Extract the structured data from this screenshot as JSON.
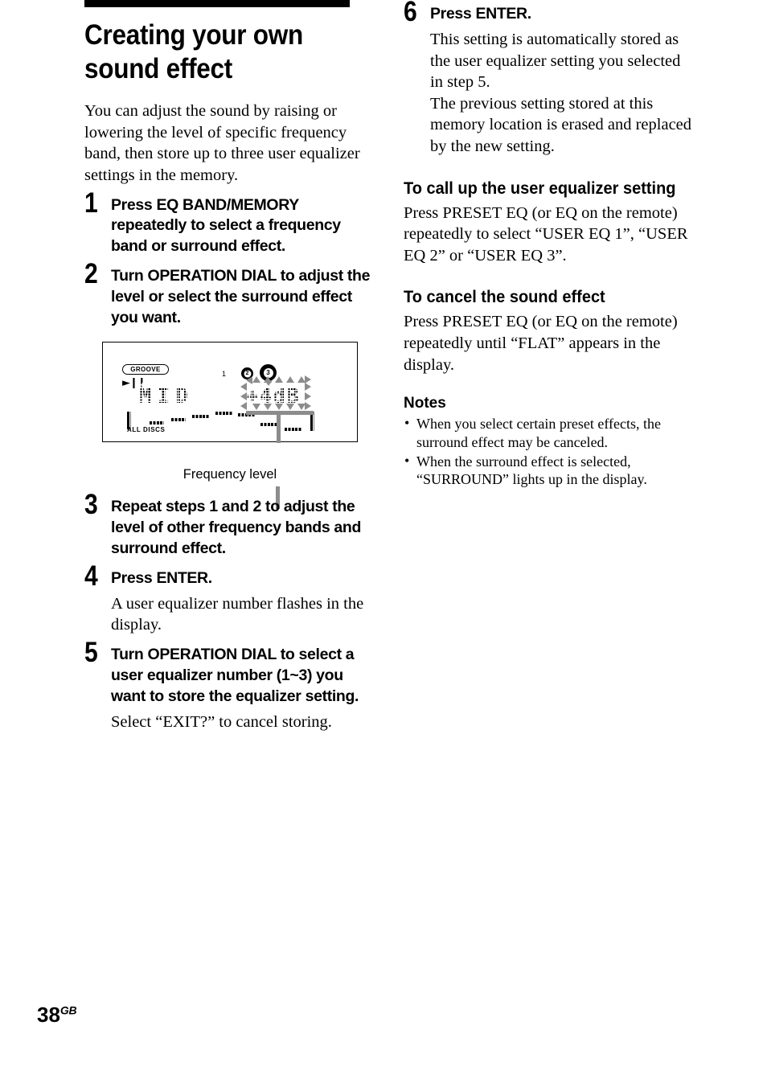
{
  "page": {
    "number": "38",
    "region_code": "GB"
  },
  "left_column": {
    "title": "Creating your own sound effect",
    "intro": "You can adjust the sound by raising or lowering the level of specific frequency band, then store up to three user equalizer settings in the memory.",
    "steps": [
      {
        "number": "1",
        "text": "Press EQ BAND/MEMORY repeatedly to select a frequency band or surround effect."
      },
      {
        "number": "2",
        "text": "Turn OPERATION DIAL to adjust the level or select the surround effect you want."
      },
      {
        "number": "3",
        "text": "Repeat steps 1 and 2 to adjust the level of other frequency bands and surround effect."
      },
      {
        "number": "4",
        "text": "Press ENTER.",
        "detail": "A user equalizer number flashes in the display."
      },
      {
        "number": "5",
        "text": "Turn OPERATION DIAL to select a user equalizer number (1~3) you want to store the equalizer setting.",
        "detail": "Select “EXIT?” to cancel storing."
      }
    ],
    "figure": {
      "caption": "Frequency level",
      "display": {
        "groove_badge": "GROOVE",
        "transport_icons": "play-pause",
        "disc_label": "1",
        "disc_numbers": [
          "2",
          "3"
        ],
        "band_text": "MID",
        "level_text": "+4dB",
        "all_discs_label": "ALL  DISCS"
      }
    }
  },
  "right_column": {
    "step6": {
      "number": "6",
      "text": "Press ENTER.",
      "detail_1": "This setting is automatically stored as the user equalizer setting you selected in step 5.",
      "detail_2": "The previous setting stored at this memory location is erased and replaced by the new setting."
    },
    "section_call_up": {
      "heading": "To call up the user equalizer setting",
      "body": "Press PRESET EQ (or EQ on the remote) repeatedly to select “USER EQ 1”, “USER EQ 2” or “USER EQ 3”."
    },
    "section_cancel": {
      "heading": "To cancel the sound effect",
      "body": "Press PRESET EQ (or EQ on the remote) repeatedly until “FLAT” appears in the display."
    },
    "notes": {
      "heading": "Notes",
      "bullet_glyph": "•",
      "items": [
        "When you select certain preset effects, the surround effect may be canceled.",
        "When the surround effect is selected, “SURROUND” lights up in the display."
      ]
    }
  }
}
